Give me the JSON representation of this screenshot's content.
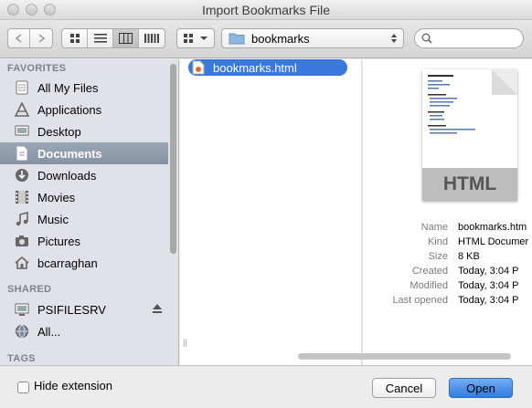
{
  "window": {
    "title": "Import Bookmarks File"
  },
  "toolbar": {
    "location_popup": {
      "label": "bookmarks",
      "icon": "folder-icon"
    },
    "search": {
      "placeholder": ""
    }
  },
  "sidebar": {
    "favorites_heading": "FAVORITES",
    "favorites": [
      {
        "label": "All My Files",
        "icon": "all-files-icon"
      },
      {
        "label": "Applications",
        "icon": "applications-icon"
      },
      {
        "label": "Desktop",
        "icon": "desktop-icon"
      },
      {
        "label": "Documents",
        "icon": "documents-icon",
        "selected": true
      },
      {
        "label": "Downloads",
        "icon": "downloads-icon"
      },
      {
        "label": "Movies",
        "icon": "movies-icon"
      },
      {
        "label": "Music",
        "icon": "music-icon"
      },
      {
        "label": "Pictures",
        "icon": "pictures-icon"
      },
      {
        "label": "bcarraghan",
        "icon": "home-icon"
      }
    ],
    "shared_heading": "SHARED",
    "shared": [
      {
        "label": "PSIFILESRV",
        "icon": "server-icon"
      },
      {
        "label": "All...",
        "icon": "network-icon"
      }
    ],
    "tags_heading": "TAGS"
  },
  "browser": {
    "files": [
      {
        "name": "bookmarks.html",
        "selected": true
      }
    ]
  },
  "preview": {
    "doc_type_label": "HTML",
    "metadata": [
      {
        "key": "Name",
        "value": "bookmarks.htm"
      },
      {
        "key": "Kind",
        "value": "HTML Documer"
      },
      {
        "key": "Size",
        "value": "8 KB"
      },
      {
        "key": "Created",
        "value": "Today, 3:04 P"
      },
      {
        "key": "Modified",
        "value": "Today, 3:04 P"
      },
      {
        "key": "Last opened",
        "value": "Today, 3:04 P"
      }
    ]
  },
  "footer": {
    "hide_extension_label": "Hide extension",
    "hide_extension_checked": false,
    "cancel_label": "Cancel",
    "open_label": "Open"
  },
  "colors": {
    "accent": "#3a78de",
    "sidebar_bg": "#dfe3e9",
    "sidebar_selected": "#8f9aab"
  }
}
